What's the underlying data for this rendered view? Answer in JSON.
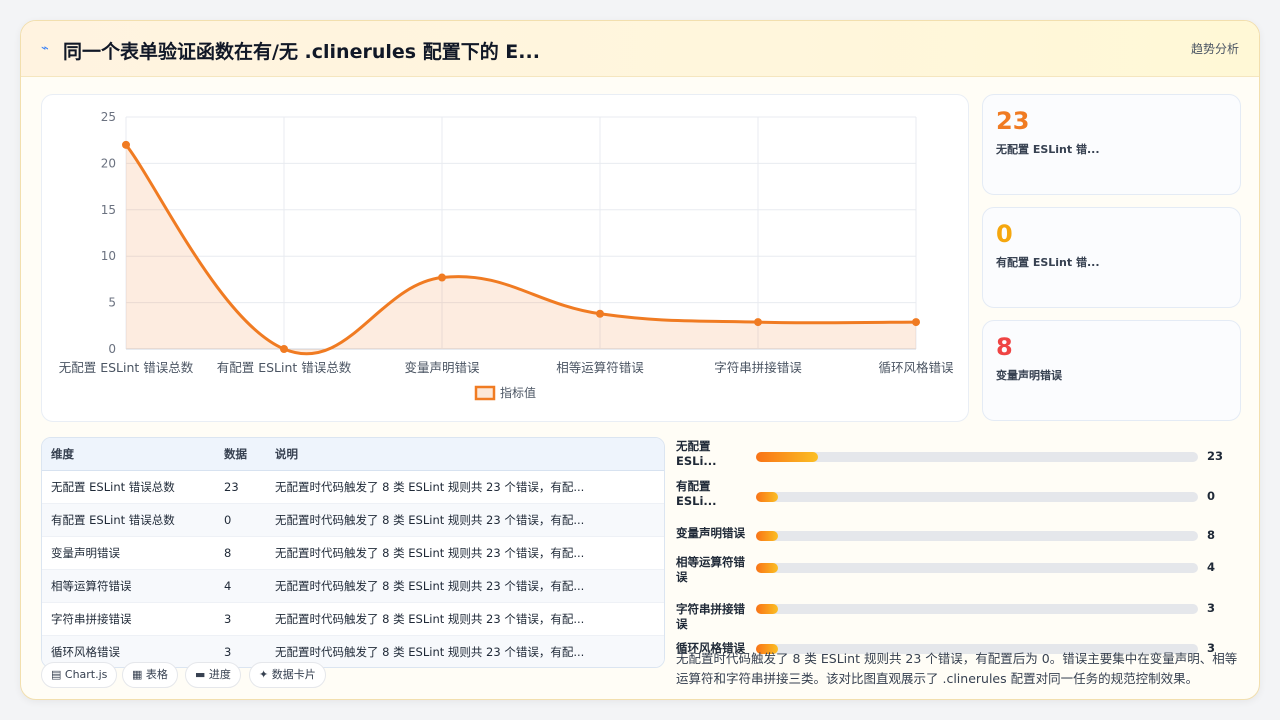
{
  "header": {
    "icon": "sparkline-icon",
    "title": "同一个表单验证函数在有/无 .clinerules 配置下的 E...",
    "tag": "趋势分析"
  },
  "chart_data": {
    "type": "line",
    "categories": [
      "无配置 ESLint 错误总数",
      "有配置 ESLint 错误总数",
      "变量声明错误",
      "相等运算符错误",
      "字符串拼接错误",
      "循环风格错误"
    ],
    "series": [
      {
        "name": "指标值",
        "values": [
          22,
          0,
          7.7,
          3.8,
          2.9,
          2.9
        ],
        "color": "#f07b22"
      }
    ],
    "yticks": [
      "0",
      "5",
      "10",
      "15",
      "20",
      "25"
    ],
    "ylim": [
      0,
      25
    ],
    "grid": true,
    "fill": true,
    "legend": "bottom"
  },
  "kpis": [
    {
      "value": "23",
      "label": "无配置 ESLint 错...",
      "color": "#f07b22"
    },
    {
      "value": "0",
      "label": "有配置 ESLint 错...",
      "color": "#f5a70f"
    },
    {
      "value": "8",
      "label": "变量声明错误",
      "color": "#ef4444"
    }
  ],
  "table": {
    "headers": [
      "维度",
      "数据",
      "说明"
    ],
    "rows": [
      [
        "无配置 ESLint 错误总数",
        "23",
        "无配置时代码触发了 8 类 ESLint 规则共 23 个错误，有配..."
      ],
      [
        "有配置 ESLint 错误总数",
        "0",
        "无配置时代码触发了 8 类 ESLint 规则共 23 个错误，有配..."
      ],
      [
        "变量声明错误",
        "8",
        "无配置时代码触发了 8 类 ESLint 规则共 23 个错误，有配..."
      ],
      [
        "相等运算符错误",
        "4",
        "无配置时代码触发了 8 类 ESLint 规则共 23 个错误，有配..."
      ],
      [
        "字符串拼接错误",
        "3",
        "无配置时代码触发了 8 类 ESLint 规则共 23 个错误，有配..."
      ],
      [
        "循环风格错误",
        "3",
        "无配置时代码触发了 8 类 ESLint 规则共 23 个错误，有配..."
      ]
    ]
  },
  "chips": [
    {
      "icon": "chart-icon",
      "label": "▤ Chart.js"
    },
    {
      "icon": "table-icon",
      "label": "▦ 表格"
    },
    {
      "icon": "progress-icon",
      "label": "▬ 进度"
    },
    {
      "icon": "sparkle-icon",
      "label": "✦ 数据卡片"
    }
  ],
  "bars": [
    {
      "label": "无配置 ESLi...",
      "value": "23",
      "fraction": 0.14
    },
    {
      "label": "有配置 ESLi...",
      "value": "0",
      "fraction": 0.05
    },
    {
      "label": "变量声明错误",
      "value": "8",
      "fraction": 0.05
    },
    {
      "label": "相等运算符错误",
      "value": "4",
      "fraction": 0.05
    },
    {
      "label": "字符串拼接错误",
      "value": "3",
      "fraction": 0.05
    },
    {
      "label": "循环风格错误",
      "value": "3",
      "fraction": 0.05
    }
  ],
  "summary": "无配置时代码触发了 8 类 ESLint 规则共 23 个错误，有配置后为 0。错误主要集中在变量声明、相等运算符和字符串拼接三类。该对比图直观展示了 .clinerules 配置对同一任务的规范控制效果。"
}
